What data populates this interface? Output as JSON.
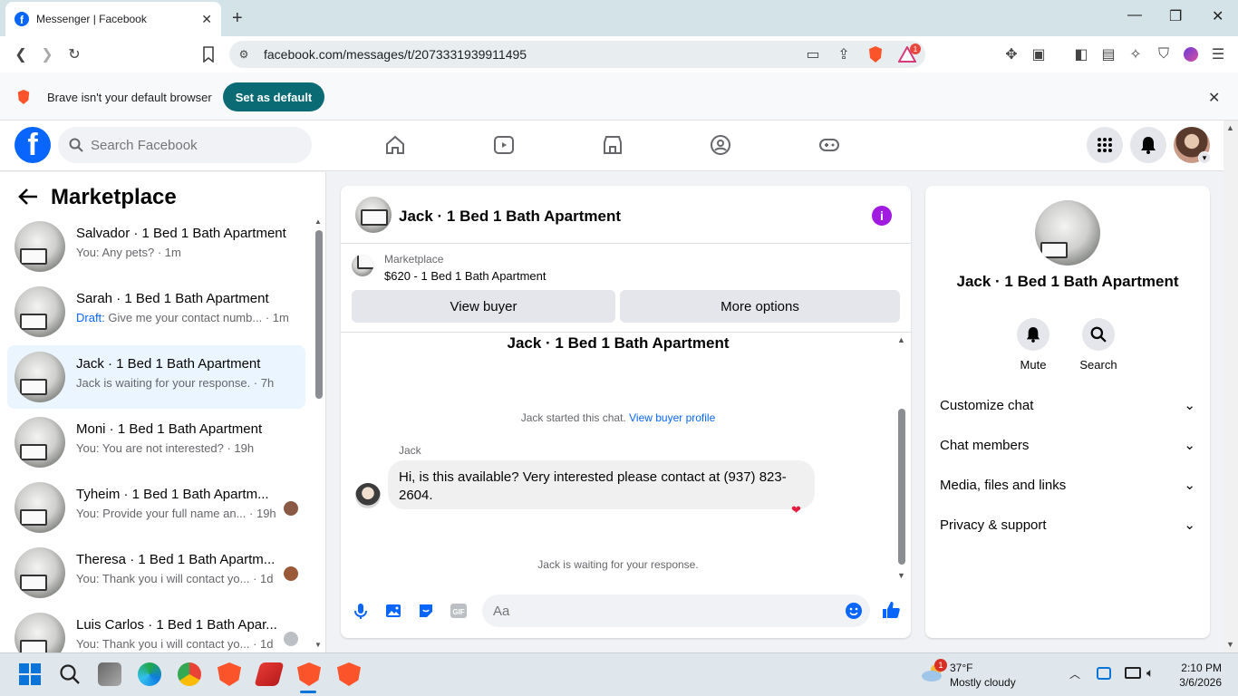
{
  "browser": {
    "tab_title": "Messenger | Facebook",
    "url": "facebook.com/messages/t/2073331939911495",
    "notification_badge": "1",
    "infobar_text": "Brave isn't your default browser",
    "set_default_label": "Set as default"
  },
  "fb": {
    "search_placeholder": "Search Facebook"
  },
  "left": {
    "title": "Marketplace",
    "conversations": [
      {
        "name": "Salvador · 1 Bed 1 Bath Apartment",
        "snippet": "You: Any pets? · 1m"
      },
      {
        "name": "Sarah · 1 Bed 1 Bath Apartment",
        "draft": "Draft:",
        "snippet": " Give me your contact numb... · 1m"
      },
      {
        "name": "Jack · 1 Bed 1 Bath Apartment",
        "snippet": "Jack is waiting for your response. · 7h"
      },
      {
        "name": "Moni · 1 Bed 1 Bath Apartment",
        "snippet": "You: You are not interested? · 19h"
      },
      {
        "name": "Tyheim · 1 Bed 1 Bath Apartm...",
        "snippet": "You: Provide your full name an... · 19h"
      },
      {
        "name": "Theresa · 1 Bed 1 Bath Apartm...",
        "snippet": "You: Thank you i will contact yo... · 1d"
      },
      {
        "name": "Luis Carlos · 1 Bed 1 Bath Apar...",
        "snippet": "You: Thank you i will contact yo... · 1d"
      }
    ]
  },
  "chat": {
    "header_name": "Jack · 1 Bed 1 Bath Apartment",
    "marketplace_label": "Marketplace",
    "listing": "$620 - 1 Bed 1 Bath Apartment",
    "view_buyer": "View buyer",
    "more_options": "More options",
    "body_title": "Jack · 1 Bed 1 Bath Apartment",
    "started_text": "Jack started this chat.",
    "view_profile": "View buyer profile",
    "sender": "Jack",
    "message": "Hi, is this available? Very interested please contact at (937) 823-2604.",
    "waiting": "Jack is waiting for your response.",
    "composer_placeholder": "Aa"
  },
  "right": {
    "name": "Jack · 1 Bed 1 Bath Apartment",
    "mute": "Mute",
    "search": "Search",
    "rows": [
      "Customize chat",
      "Chat members",
      "Media, files and links",
      "Privacy & support"
    ]
  },
  "taskbar": {
    "temp": "37°F",
    "weather": "Mostly cloudy",
    "weather_badge": "1",
    "time": "2:10 PM",
    "date": "3/6/2026"
  },
  "colors": {
    "fb_blue": "#0866ff",
    "active_conv": "#ebf5ff",
    "brave_button": "#0b6b75"
  }
}
